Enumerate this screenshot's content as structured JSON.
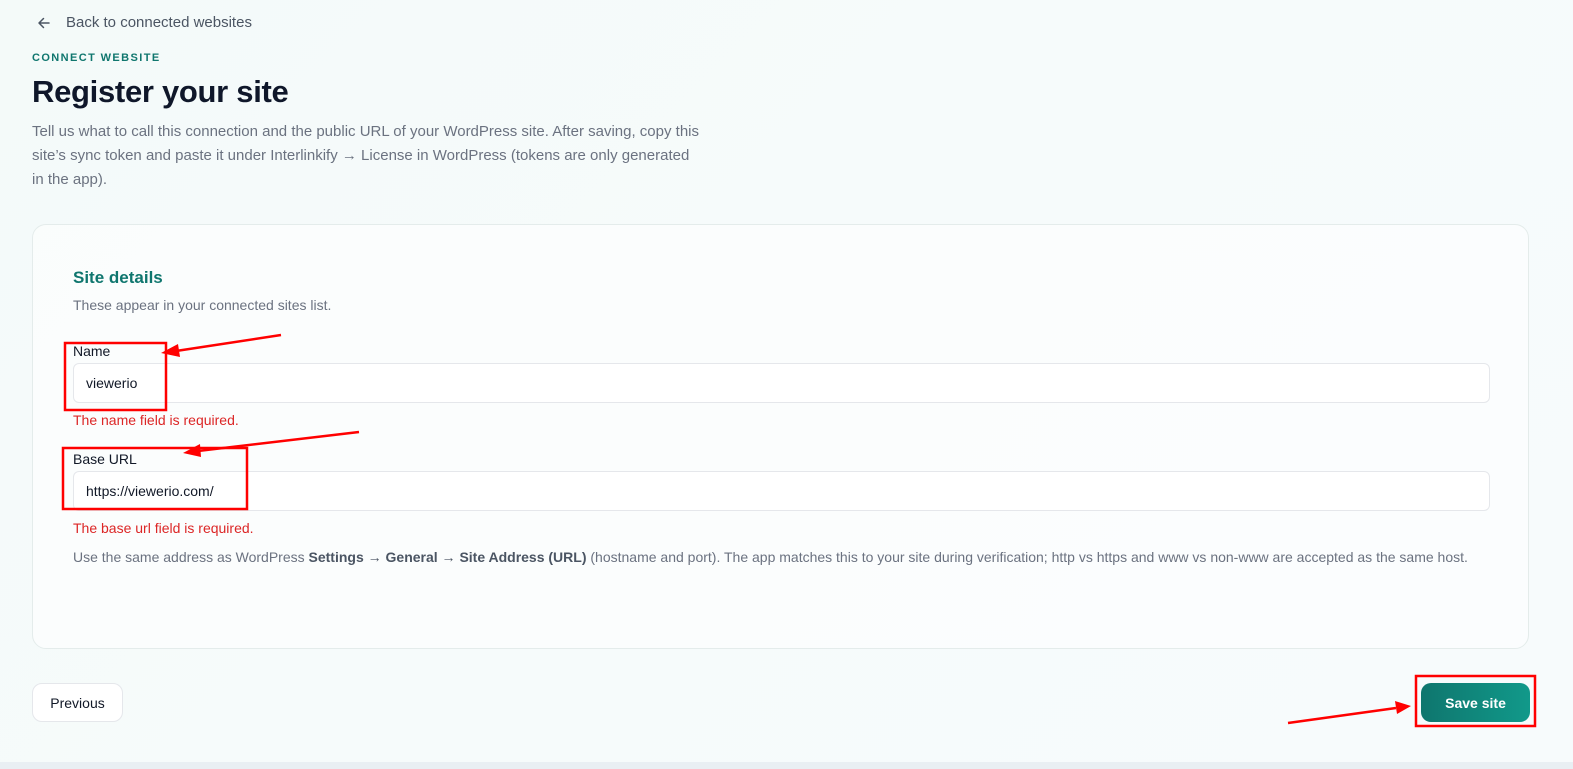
{
  "nav": {
    "back_label": "Back to connected websites",
    "back_icon": "arrow-left-icon"
  },
  "header": {
    "eyebrow": "CONNECT WEBSITE",
    "title": "Register your site",
    "description": "Tell us what to call this connection and the public URL of your WordPress site. After saving, copy this site’s sync token and paste it under Interlinkify → License in WordPress (tokens are only generated in the app)."
  },
  "form": {
    "section_title": "Site details",
    "section_description": "These appear in your connected sites list.",
    "name": {
      "label": "Name",
      "value": "viewerio",
      "error": "The name field is required."
    },
    "base_url": {
      "label": "Base URL",
      "value": "https://viewerio.com/",
      "error": "The base url field is required."
    },
    "help": {
      "prefix": "Use the same address as WordPress ",
      "bold": "Settings → General → Site Address (URL)",
      "suffix": " (hostname and port). The app matches this to your site during verification; http vs https and www vs non-www are accepted as the same host."
    }
  },
  "actions": {
    "previous_label": "Previous",
    "save_label": "Save site"
  },
  "colors": {
    "accent": "#0f766e",
    "error": "#dc2626",
    "annotation": "#ff0000"
  }
}
